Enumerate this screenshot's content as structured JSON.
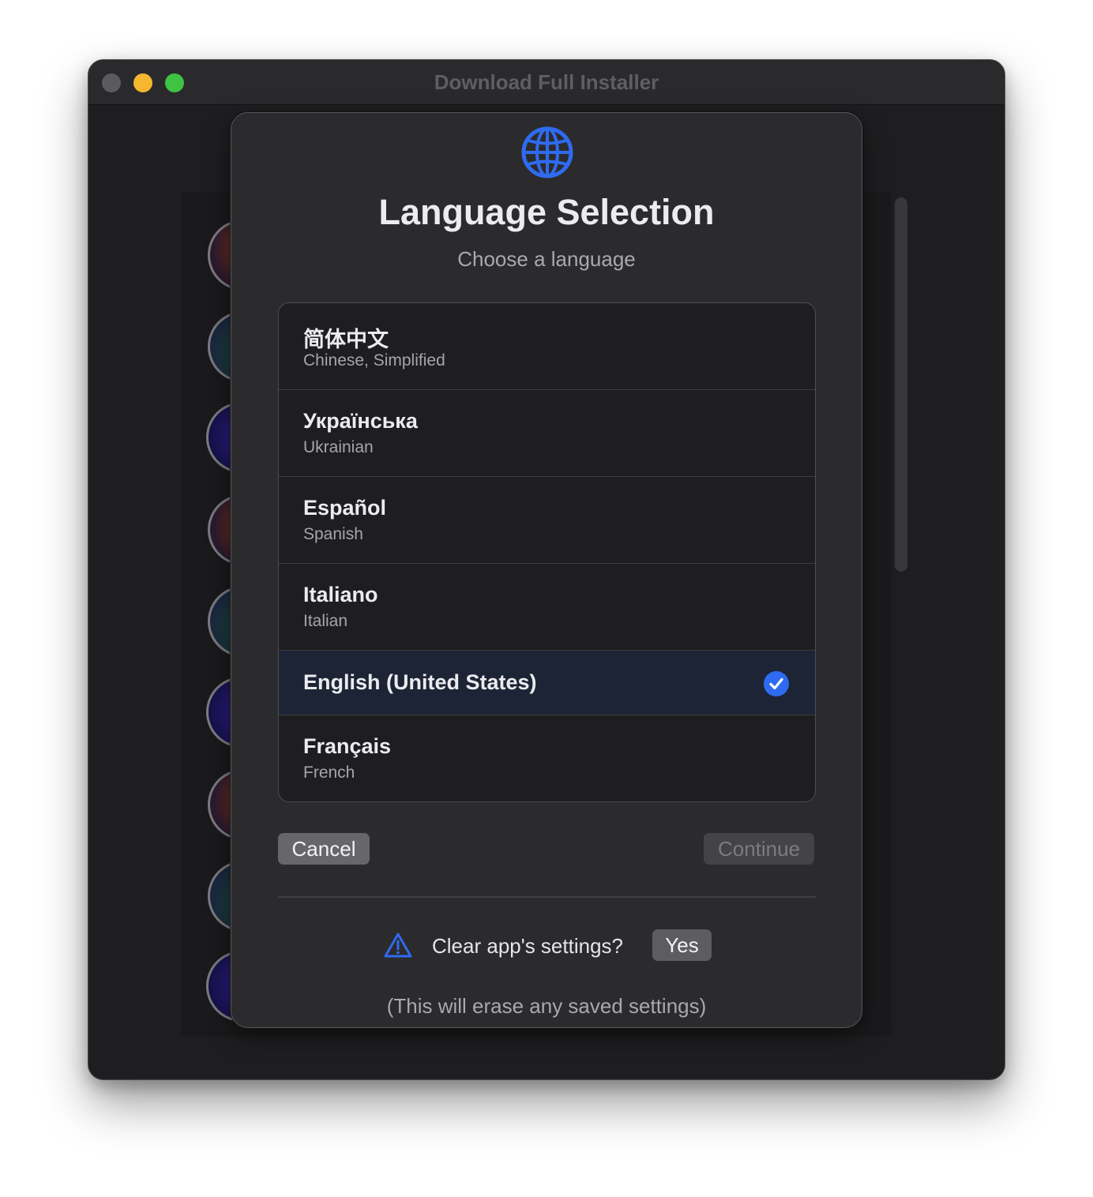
{
  "window": {
    "title": "Download Full Installer"
  },
  "sheet": {
    "title": "Language Selection",
    "subtitle": "Choose a language",
    "languages": [
      {
        "native": "简体中文",
        "english": "Chinese, Simplified",
        "selected": false
      },
      {
        "native": "Українська",
        "english": "Ukrainian",
        "selected": false
      },
      {
        "native": "Español",
        "english": "Spanish",
        "selected": false
      },
      {
        "native": "Italiano",
        "english": "Italian",
        "selected": false
      },
      {
        "native": "English (United States)",
        "english": "",
        "selected": true
      },
      {
        "native": "Français",
        "english": "French",
        "selected": false
      }
    ],
    "cancel_label": "Cancel",
    "continue_label": "Continue",
    "clear_label": "Clear app's settings?",
    "yes_label": "Yes",
    "erase_note": "(This will erase any saved settings)"
  },
  "icons": {
    "globe": "globe-icon",
    "check": "checkmark-circle-icon",
    "warning": "warning-triangle-icon"
  },
  "colors": {
    "accent": "#2f6bf0",
    "selected_row": "#1c2436",
    "sheet_bg": "#2b2b2d",
    "close": "#5b5b5e",
    "minimize": "#f4b72f",
    "zoom": "#3ec343"
  }
}
